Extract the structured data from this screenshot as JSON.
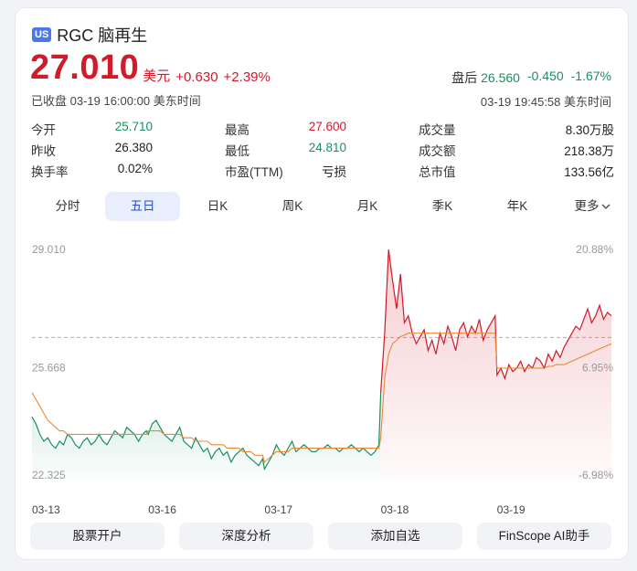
{
  "header": {
    "market_badge": "US",
    "name": "RGC 脑再生"
  },
  "quote": {
    "price": "27.010",
    "currency": "美元",
    "change": "+0.630",
    "change_pct": "+2.39%",
    "status": "已收盘 03-19 16:00:00 美东时间"
  },
  "after_hours": {
    "label": "盘后",
    "price": "26.560",
    "change": "-0.450",
    "change_pct": "-1.67%",
    "time": "03-19 19:45:58 美东时间"
  },
  "stats": [
    [
      {
        "label": "今开",
        "value": "25.710",
        "color": "green"
      },
      {
        "label": "最高",
        "value": "27.600",
        "color": "red"
      },
      {
        "label": "成交量",
        "value": "8.30万股",
        "color": "none"
      }
    ],
    [
      {
        "label": "昨收",
        "value": "26.380",
        "color": "none"
      },
      {
        "label": "最低",
        "value": "24.810",
        "color": "green"
      },
      {
        "label": "成交额",
        "value": "218.38万",
        "color": "none"
      }
    ],
    [
      {
        "label": "换手率",
        "value": "0.02%",
        "color": "none"
      },
      {
        "label": "市盈(TTM)",
        "value": "亏损",
        "color": "none"
      },
      {
        "label": "总市值",
        "value": "133.56亿",
        "color": "none"
      }
    ]
  ],
  "tabs": [
    "分时",
    "五日",
    "日K",
    "周K",
    "月K",
    "季K",
    "年K",
    "更多"
  ],
  "active_tab": "五日",
  "buttons": [
    "股票开户",
    "深度分析",
    "添加自选",
    "FinScope AI助手"
  ],
  "colors": {
    "up": "#d11a2a",
    "down": "#1a8f5e",
    "avg": "#e8893a",
    "accent": "#2850c8"
  },
  "chart_data": {
    "type": "line",
    "title": "",
    "y_labels_left": [
      "29.010",
      "25.668",
      "22.325"
    ],
    "y_labels_right": [
      "20.88%",
      "6.95%",
      "-6.98%"
    ],
    "ylim": [
      22.325,
      29.01
    ],
    "prev_close": 26.38,
    "x_labels": [
      "03-13",
      "03-16",
      "03-17",
      "03-18",
      "03-19"
    ],
    "days": [
      {
        "label": "03-13",
        "series": [
          24.1,
          23.9,
          23.6,
          23.4,
          23.5,
          23.3,
          23.2,
          23.4,
          23.3,
          23.6,
          23.5,
          23.3,
          23.2,
          23.4,
          23.5,
          23.3,
          23.4,
          23.6,
          23.4,
          23.3,
          23.5,
          23.7,
          23.6,
          23.5,
          23.8,
          23.7,
          23.6,
          23.4,
          23.6,
          23.7
        ],
        "avg": [
          24.8,
          24.6,
          24.4,
          24.2,
          24.0,
          23.9,
          23.8,
          23.7,
          23.7,
          23.6,
          23.6,
          23.6,
          23.6,
          23.6,
          23.6,
          23.6,
          23.6,
          23.6,
          23.6,
          23.6,
          23.6,
          23.6,
          23.6,
          23.6,
          23.6,
          23.6,
          23.6,
          23.6,
          23.6,
          23.6
        ]
      },
      {
        "label": "03-16",
        "series": [
          23.6,
          23.9,
          24.0,
          23.8,
          23.6,
          23.5,
          23.4,
          23.6,
          23.8,
          23.4,
          23.3,
          23.2,
          23.5,
          23.3,
          23.1,
          23.2,
          22.9,
          23.1,
          23.2,
          23.0,
          23.1,
          22.8,
          23.0,
          23.1,
          23.2,
          23.0,
          22.9,
          22.8,
          22.7,
          22.9
        ],
        "avg": [
          23.7,
          23.7,
          23.7,
          23.7,
          23.6,
          23.6,
          23.6,
          23.6,
          23.6,
          23.5,
          23.5,
          23.5,
          23.4,
          23.4,
          23.4,
          23.4,
          23.3,
          23.3,
          23.3,
          23.3,
          23.2,
          23.2,
          23.2,
          23.2,
          23.1,
          23.1,
          23.1,
          23.0,
          23.0,
          23.0
        ]
      },
      {
        "label": "03-17",
        "series": [
          22.6,
          22.8,
          23.0,
          23.3,
          23.1,
          23.0,
          23.2,
          23.4,
          23.1,
          23.2,
          23.3,
          23.2,
          23.1,
          23.1,
          23.2,
          23.2,
          23.3,
          23.2,
          23.2,
          23.1,
          23.2,
          23.2,
          23.3,
          23.2,
          23.1,
          23.2,
          23.1,
          23.0,
          23.1,
          23.3
        ],
        "avg": [
          22.8,
          22.9,
          23.0,
          23.1,
          23.1,
          23.1,
          23.1,
          23.2,
          23.2,
          23.2,
          23.2,
          23.2,
          23.2,
          23.2,
          23.2,
          23.2,
          23.2,
          23.2,
          23.2,
          23.2,
          23.2,
          23.2,
          23.2,
          23.2,
          23.2,
          23.2,
          23.2,
          23.2,
          23.2,
          23.2
        ]
      },
      {
        "label": "03-18",
        "series": [
          24.8,
          26.5,
          28.9,
          28.0,
          27.2,
          28.2,
          26.8,
          27.0,
          26.5,
          26.2,
          26.4,
          26.6,
          26.0,
          26.3,
          25.9,
          26.5,
          26.2,
          26.7,
          26.4,
          26.0,
          26.6,
          26.8,
          26.4,
          26.7,
          26.5,
          26.9,
          26.3,
          26.6,
          26.8,
          27.0
        ],
        "avg": [
          23.5,
          25.2,
          25.9,
          26.2,
          26.3,
          26.4,
          26.45,
          26.5,
          26.5,
          26.5,
          26.5,
          26.5,
          26.5,
          26.5,
          26.5,
          26.5,
          26.5,
          26.5,
          26.5,
          26.5,
          26.5,
          26.5,
          26.5,
          26.5,
          26.5,
          26.5,
          26.5,
          26.5,
          26.5,
          26.5
        ]
      },
      {
        "label": "03-19",
        "series": [
          25.3,
          25.5,
          25.2,
          25.6,
          25.4,
          25.5,
          25.7,
          25.4,
          25.6,
          25.5,
          25.8,
          25.7,
          25.5,
          25.9,
          25.7,
          26.0,
          25.8,
          26.1,
          26.3,
          26.5,
          26.7,
          26.6,
          26.9,
          27.2,
          26.8,
          27.0,
          27.3,
          26.9,
          27.1,
          27.0
        ],
        "avg": [
          25.5,
          25.5,
          25.5,
          25.5,
          25.5,
          25.5,
          25.5,
          25.5,
          25.5,
          25.5,
          25.5,
          25.5,
          25.5,
          25.55,
          25.55,
          25.6,
          25.6,
          25.6,
          25.65,
          25.7,
          25.75,
          25.8,
          25.85,
          25.9,
          25.95,
          26.0,
          26.05,
          26.1,
          26.15,
          26.2
        ]
      }
    ]
  }
}
